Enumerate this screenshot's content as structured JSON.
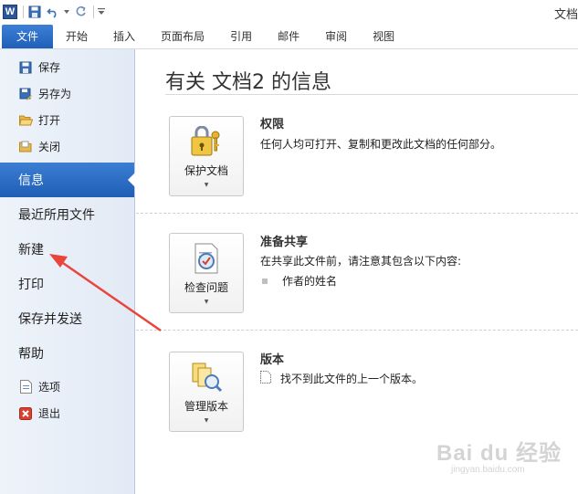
{
  "app": {
    "title": "文档",
    "logo": "W"
  },
  "quick_access": {
    "items": [
      {
        "icon": "word-app-icon"
      },
      {
        "icon": "save-icon"
      },
      {
        "icon": "undo-icon"
      },
      {
        "icon": "redo-icon"
      },
      {
        "icon": "customize-qat-icon"
      }
    ]
  },
  "ribbon": {
    "tabs": [
      "文件",
      "开始",
      "插入",
      "页面布局",
      "引用",
      "邮件",
      "审阅",
      "视图"
    ],
    "active_tab": "文件"
  },
  "nav": {
    "small_top": [
      {
        "label": "保存",
        "icon": "save-icon"
      },
      {
        "label": "另存为",
        "icon": "save-as-icon"
      },
      {
        "label": "打开",
        "icon": "open-folder-icon"
      },
      {
        "label": "关闭",
        "icon": "close-folder-icon"
      }
    ],
    "big": [
      {
        "label": "信息",
        "active": true
      },
      {
        "label": "最近所用文件"
      },
      {
        "label": "新建"
      },
      {
        "label": "打印"
      },
      {
        "label": "保存并发送"
      },
      {
        "label": "帮助"
      }
    ],
    "small_bottom": [
      {
        "label": "选项",
        "icon": "options-icon"
      },
      {
        "label": "退出",
        "icon": "exit-icon"
      }
    ]
  },
  "main": {
    "title": "有关 文档2 的信息",
    "sections": [
      {
        "button_label": "保护文档",
        "button_icon": "lock-keys-icon",
        "title": "权限",
        "description": "任何人均可打开、复制和更改此文档的任何部分。"
      },
      {
        "button_label": "检查问题",
        "button_icon": "inspect-document-icon",
        "title": "准备共享",
        "description": "在共享此文件前，请注意其包含以下内容:",
        "bullet": "作者的姓名"
      },
      {
        "button_label": "管理版本",
        "button_icon": "manage-versions-icon",
        "title": "版本",
        "bullet": "找不到此文件的上一个版本。"
      }
    ]
  },
  "colors": {
    "accent": "#2b6cc4",
    "arrow": "#e8453c"
  },
  "watermark": {
    "main": "Bai du 经验",
    "sub": "jingyan.baidu.com"
  }
}
